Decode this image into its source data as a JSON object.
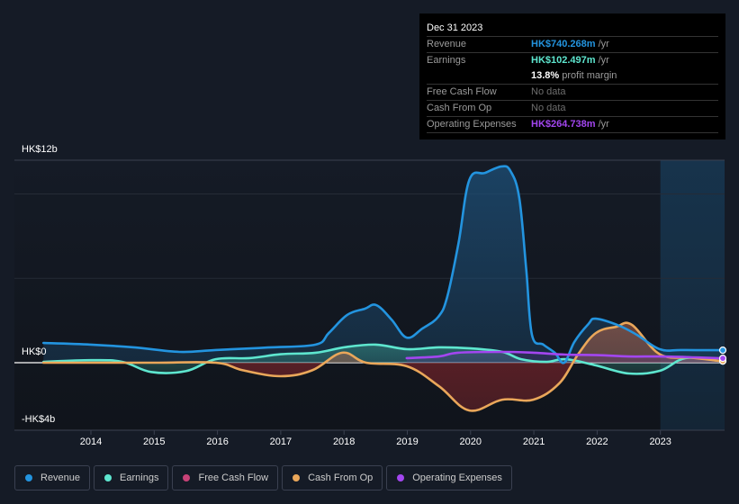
{
  "tooltip": {
    "date": "Dec 31 2023",
    "rows": [
      {
        "label": "Revenue",
        "value": "HK$740.268m",
        "suffix": " /yr",
        "color": "#2394df"
      },
      {
        "label": "Earnings",
        "value": "HK$102.497m",
        "suffix": " /yr",
        "color": "#5ee6cf"
      },
      {
        "label": "",
        "value": "13.8%",
        "suffix": " profit margin",
        "color": "#ffffff"
      },
      {
        "label": "Free Cash Flow",
        "value": "No data",
        "suffix": "",
        "color": ""
      },
      {
        "label": "Cash From Op",
        "value": "No data",
        "suffix": "",
        "color": ""
      },
      {
        "label": "Operating Expenses",
        "value": "HK$264.738m",
        "suffix": " /yr",
        "color": "#a346f0"
      }
    ]
  },
  "legend": [
    {
      "label": "Revenue",
      "color": "#2394df"
    },
    {
      "label": "Earnings",
      "color": "#5ee6cf"
    },
    {
      "label": "Free Cash Flow",
      "color": "#c74277"
    },
    {
      "label": "Cash From Op",
      "color": "#eaa75a"
    },
    {
      "label": "Operating Expenses",
      "color": "#a346f0"
    }
  ],
  "chart_data": {
    "type": "area",
    "title": "",
    "xlabel": "",
    "ylabel": "",
    "currency": "HK$",
    "y_unit": "billions",
    "ylim": [
      -4,
      12
    ],
    "y_tick_labels": [
      "HK$12b",
      "HK$0",
      "-HK$4b"
    ],
    "y_tick_values": [
      12,
      0,
      -4
    ],
    "gridlines": [
      12,
      10,
      5,
      0
    ],
    "x_tick_labels": [
      "2014",
      "2015",
      "2016",
      "2017",
      "2018",
      "2019",
      "2020",
      "2021",
      "2022",
      "2023"
    ],
    "xlim": [
      2013.33,
      2024.0
    ],
    "highlight_from": 2023.0,
    "series": [
      {
        "name": "Revenue",
        "color": "#2394df",
        "points": [
          [
            2013.25,
            1.17
          ],
          [
            2014.0,
            1.07
          ],
          [
            2014.7,
            0.9
          ],
          [
            2015.4,
            0.64
          ],
          [
            2015.97,
            0.75
          ],
          [
            2016.8,
            0.9
          ],
          [
            2017.55,
            1.07
          ],
          [
            2017.76,
            1.76
          ],
          [
            2018.05,
            2.83
          ],
          [
            2018.33,
            3.2
          ],
          [
            2018.51,
            3.41
          ],
          [
            2018.75,
            2.56
          ],
          [
            2018.99,
            1.49
          ],
          [
            2019.24,
            2.03
          ],
          [
            2019.49,
            2.72
          ],
          [
            2019.63,
            3.89
          ],
          [
            2019.81,
            7.09
          ],
          [
            2019.98,
            10.83
          ],
          [
            2020.23,
            11.25
          ],
          [
            2020.49,
            11.63
          ],
          [
            2020.63,
            11.36
          ],
          [
            2020.77,
            9.76
          ],
          [
            2020.88,
            5.49
          ],
          [
            2020.97,
            1.65
          ],
          [
            2021.15,
            1.07
          ],
          [
            2021.33,
            0.59
          ],
          [
            2021.48,
            0.0
          ],
          [
            2021.64,
            1.23
          ],
          [
            2021.86,
            2.29
          ],
          [
            2021.98,
            2.61
          ],
          [
            2022.35,
            2.19
          ],
          [
            2022.63,
            1.65
          ],
          [
            2022.99,
            0.8
          ],
          [
            2023.34,
            0.75
          ],
          [
            2023.95,
            0.74
          ]
        ]
      },
      {
        "name": "Earnings",
        "color": "#5ee6cf",
        "points": [
          [
            2013.25,
            0.05
          ],
          [
            2014.0,
            0.15
          ],
          [
            2014.5,
            0.05
          ],
          [
            2014.95,
            -0.55
          ],
          [
            2015.5,
            -0.5
          ],
          [
            2015.97,
            0.21
          ],
          [
            2016.5,
            0.27
          ],
          [
            2017.0,
            0.5
          ],
          [
            2017.55,
            0.59
          ],
          [
            2018.0,
            0.91
          ],
          [
            2018.5,
            1.07
          ],
          [
            2019.0,
            0.8
          ],
          [
            2019.5,
            0.91
          ],
          [
            2020.0,
            0.85
          ],
          [
            2020.5,
            0.64
          ],
          [
            2020.8,
            0.21
          ],
          [
            2021.2,
            0.05
          ],
          [
            2021.5,
            0.21
          ],
          [
            2021.98,
            -0.16
          ],
          [
            2022.5,
            -0.64
          ],
          [
            2022.99,
            -0.48
          ],
          [
            2023.4,
            0.27
          ],
          [
            2023.95,
            0.1
          ]
        ]
      },
      {
        "name": "Free Cash Flow",
        "color": "#c74277",
        "points": []
      },
      {
        "name": "Cash From Op",
        "color": "#eaa75a",
        "points": [
          [
            2013.25,
            0.0
          ],
          [
            2014.0,
            0.0
          ],
          [
            2015.0,
            0.0
          ],
          [
            2015.97,
            0.0
          ],
          [
            2016.4,
            -0.45
          ],
          [
            2017.0,
            -0.8
          ],
          [
            2017.5,
            -0.45
          ],
          [
            2017.97,
            0.59
          ],
          [
            2018.35,
            0.0
          ],
          [
            2018.99,
            -0.21
          ],
          [
            2019.5,
            -1.39
          ],
          [
            2019.98,
            -2.83
          ],
          [
            2020.5,
            -2.19
          ],
          [
            2020.99,
            -2.19
          ],
          [
            2021.4,
            -1.23
          ],
          [
            2021.7,
            0.5
          ],
          [
            2021.98,
            1.76
          ],
          [
            2022.3,
            2.13
          ],
          [
            2022.55,
            2.24
          ],
          [
            2022.99,
            0.5
          ],
          [
            2023.5,
            0.3
          ],
          [
            2023.95,
            0.1
          ]
        ]
      },
      {
        "name": "Operating Expenses",
        "color": "#a346f0",
        "points": [
          [
            2018.99,
            0.27
          ],
          [
            2019.5,
            0.37
          ],
          [
            2019.8,
            0.59
          ],
          [
            2020.5,
            0.64
          ],
          [
            2021.0,
            0.59
          ],
          [
            2021.5,
            0.48
          ],
          [
            2022.0,
            0.45
          ],
          [
            2022.5,
            0.37
          ],
          [
            2023.0,
            0.37
          ],
          [
            2023.5,
            0.32
          ],
          [
            2023.95,
            0.26
          ]
        ]
      }
    ]
  }
}
